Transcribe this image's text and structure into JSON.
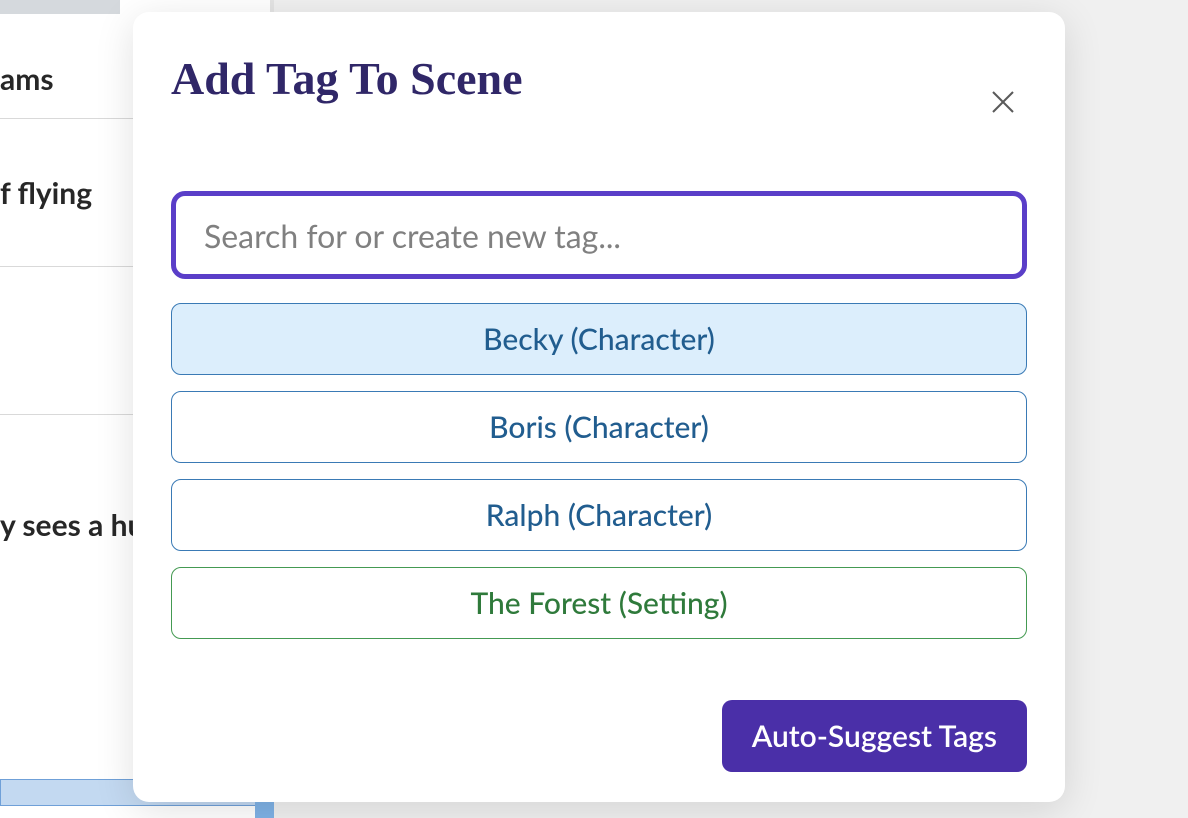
{
  "background": {
    "row1": "ams",
    "row2": "f flying",
    "row3": "",
    "row4": "y sees a hu"
  },
  "modal": {
    "title": "Add Tag To Scene",
    "search_placeholder": "Search for or create new tag...",
    "tags": [
      {
        "label": "Becky (Character)",
        "kind": "character",
        "selected": true
      },
      {
        "label": "Boris (Character)",
        "kind": "character",
        "selected": false
      },
      {
        "label": "Ralph (Character)",
        "kind": "character",
        "selected": false
      },
      {
        "label": "The Forest (Setting)",
        "kind": "setting",
        "selected": false
      }
    ],
    "auto_suggest_label": "Auto-Suggest Tags"
  }
}
